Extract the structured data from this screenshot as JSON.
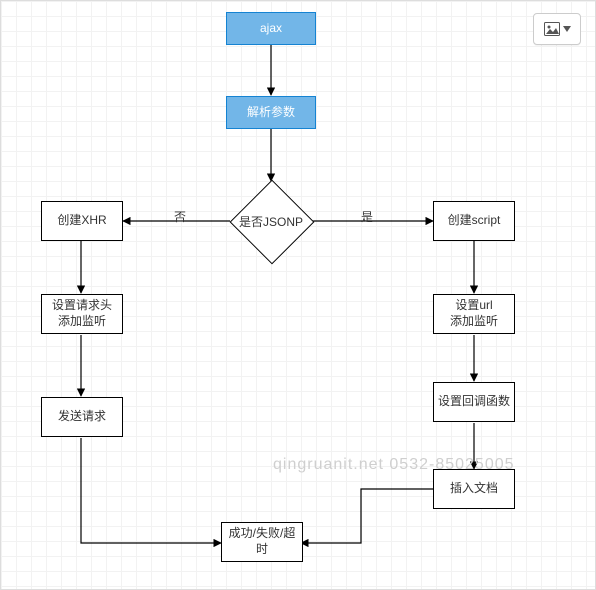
{
  "toolbar": {
    "image_button_title": "Insert image"
  },
  "watermark": "qingruanit.net 0532-85025005",
  "nodes": {
    "ajax": "ajax",
    "parse": "解析参数",
    "decision": "是否JSONP",
    "xhr": "创建XHR",
    "script": "创建script",
    "set_header": "设置请求头\n添加监听",
    "set_url": "设置url\n添加监听",
    "send": "发送请求",
    "callback": "设置回调函数",
    "insert_doc": "插入文档",
    "result": "成功/失败/超时"
  },
  "edges": {
    "no": "否",
    "yes": "是"
  }
}
